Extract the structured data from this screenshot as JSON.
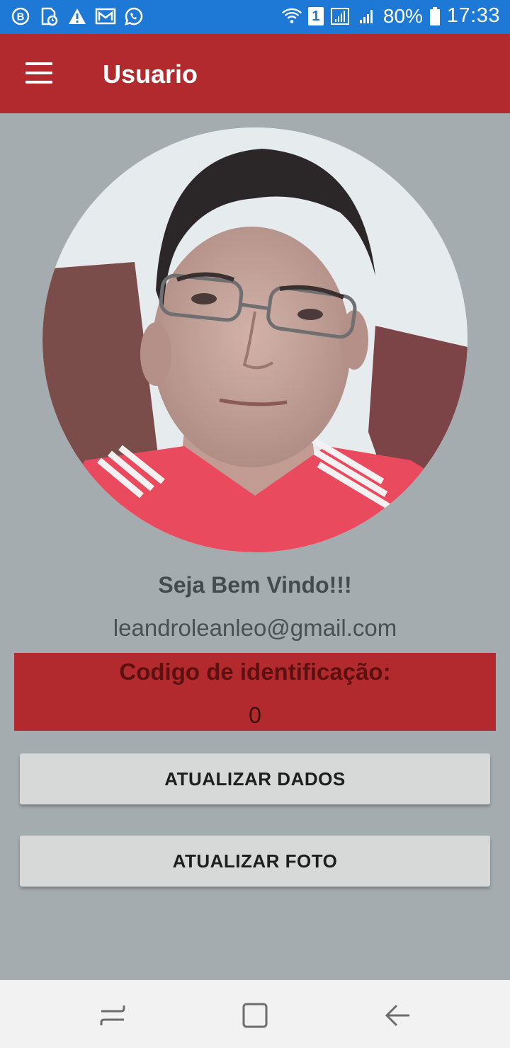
{
  "status_bar": {
    "left_icons": [
      "business-chat-icon",
      "sim-calendar-icon",
      "warning-icon",
      "gallery-icon",
      "whatsapp-icon"
    ],
    "sim_badge": "1",
    "battery": "80%",
    "time": "17:33"
  },
  "app_bar": {
    "title": "Usuario"
  },
  "profile": {
    "welcome": "Seja Bem Vindo!!!",
    "email": "leandroleanleo@gmail.com",
    "id_label": "Codigo de identificação:",
    "id_value": "0"
  },
  "buttons": {
    "update_data": "ATUALIZAR DADOS",
    "update_photo": "ATUALIZAR FOTO"
  },
  "colors": {
    "status_bar": "#1e78d6",
    "primary": "#b22a2e",
    "background": "#a5acaf",
    "button": "#d7d9d9",
    "shirt": "#e94a5e"
  }
}
